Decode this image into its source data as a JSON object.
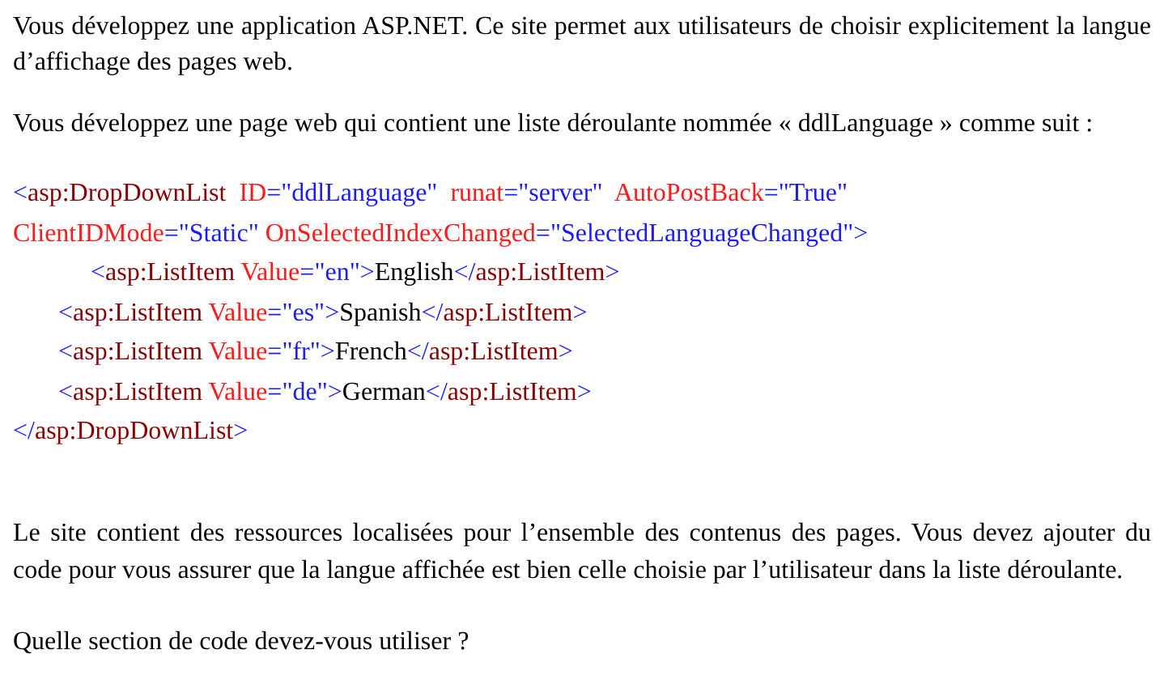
{
  "intro": "Vous développez une application ASP.NET. Ce site permet aux utilisateurs de choisir explicitement la langue d’affichage des pages web.",
  "context": "Vous développez une page web qui contient une liste déroulante nommée « ddlLanguage » comme suit :",
  "code_lines": [
    {
      "kind": "top",
      "tokens": [
        {
          "kind": "punct",
          "text": "<"
        },
        {
          "kind": "tag",
          "text": "asp:DropDownList"
        },
        {
          "kind": "attr",
          "text": "  ID"
        },
        {
          "kind": "punct",
          "text": "="
        },
        {
          "kind": "value",
          "text": "\"ddlLanguage\""
        },
        {
          "kind": "attr",
          "text": "  runat"
        },
        {
          "kind": "punct",
          "text": "="
        },
        {
          "kind": "value",
          "text": "\"server\""
        },
        {
          "kind": "attr",
          "text": "  AutoPostBack"
        },
        {
          "kind": "punct",
          "text": "="
        },
        {
          "kind": "value",
          "text": "\"True\""
        }
      ]
    },
    {
      "kind": "top",
      "tokens": [
        {
          "kind": "attr",
          "text": "ClientIDMode"
        },
        {
          "kind": "punct",
          "text": "="
        },
        {
          "kind": "value",
          "text": "\"Static\""
        },
        {
          "kind": "attr",
          "text": " OnSelectedIndexChanged"
        },
        {
          "kind": "punct",
          "text": "="
        },
        {
          "kind": "value",
          "text": "\"SelectedLanguageChanged\""
        },
        {
          "kind": "punct",
          "text": ">"
        }
      ]
    },
    {
      "kind": "deep",
      "tokens": [
        {
          "kind": "punct",
          "text": "<"
        },
        {
          "kind": "tag",
          "text": "asp:ListItem"
        },
        {
          "kind": "attr",
          "text": " Value"
        },
        {
          "kind": "punct",
          "text": "="
        },
        {
          "kind": "value",
          "text": "\"en\""
        },
        {
          "kind": "punct",
          "text": ">"
        },
        {
          "kind": "content",
          "text": "English"
        },
        {
          "kind": "punct",
          "text": "</"
        },
        {
          "kind": "tag",
          "text": "asp:ListItem"
        },
        {
          "kind": "punct",
          "text": ">"
        }
      ]
    },
    {
      "kind": "nested",
      "tokens": [
        {
          "kind": "punct",
          "text": "<"
        },
        {
          "kind": "tag",
          "text": "asp:ListItem"
        },
        {
          "kind": "attr",
          "text": " Value"
        },
        {
          "kind": "punct",
          "text": "="
        },
        {
          "kind": "value",
          "text": "\"es\""
        },
        {
          "kind": "punct",
          "text": ">"
        },
        {
          "kind": "content",
          "text": "Spanish"
        },
        {
          "kind": "punct",
          "text": "</"
        },
        {
          "kind": "tag",
          "text": "asp:ListItem"
        },
        {
          "kind": "punct",
          "text": ">"
        }
      ]
    },
    {
      "kind": "nested",
      "tokens": [
        {
          "kind": "punct",
          "text": "<"
        },
        {
          "kind": "tag",
          "text": "asp:ListItem"
        },
        {
          "kind": "attr",
          "text": " Value"
        },
        {
          "kind": "punct",
          "text": "="
        },
        {
          "kind": "value",
          "text": "\"fr\""
        },
        {
          "kind": "punct",
          "text": ">"
        },
        {
          "kind": "content",
          "text": "French"
        },
        {
          "kind": "punct",
          "text": "</"
        },
        {
          "kind": "tag",
          "text": "asp:ListItem"
        },
        {
          "kind": "punct",
          "text": ">"
        }
      ]
    },
    {
      "kind": "nested",
      "tokens": [
        {
          "kind": "punct",
          "text": "<"
        },
        {
          "kind": "tag",
          "text": "asp:ListItem"
        },
        {
          "kind": "attr",
          "text": " Value"
        },
        {
          "kind": "punct",
          "text": "="
        },
        {
          "kind": "value",
          "text": "\"de\""
        },
        {
          "kind": "punct",
          "text": ">"
        },
        {
          "kind": "content",
          "text": "German"
        },
        {
          "kind": "punct",
          "text": "</"
        },
        {
          "kind": "tag",
          "text": "asp:ListItem"
        },
        {
          "kind": "punct",
          "text": ">"
        }
      ]
    },
    {
      "kind": "top",
      "tokens": [
        {
          "kind": "punct",
          "text": "</"
        },
        {
          "kind": "tag",
          "text": "asp:DropDownList"
        },
        {
          "kind": "punct",
          "text": ">"
        }
      ]
    }
  ],
  "requirement": "Le site contient des ressources localisées pour l’ensemble des contenus des pages. Vous devez ajouter du code pour vous assurer que la langue affichée est bien celle choisie par l’utilisateur dans la liste déroulante.",
  "question": "Quelle section de code devez-vous utiliser ?"
}
